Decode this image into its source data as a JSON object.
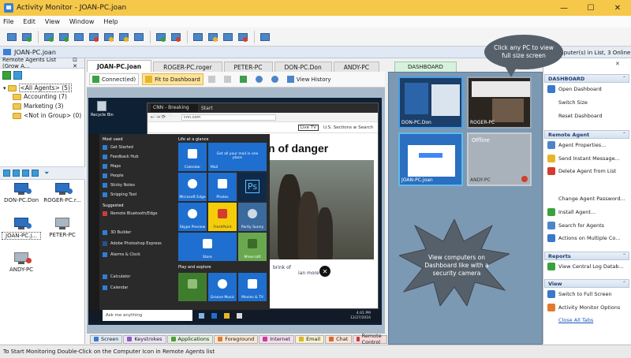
{
  "window": {
    "title": "Activity Monitor - JOAN-PC.joan",
    "min": "—",
    "max": "☐",
    "close": "✕"
  },
  "menu": [
    "File",
    "Edit",
    "View",
    "Window",
    "Help"
  ],
  "location": "JOAN-PC.joan",
  "left": {
    "header": "Remote Agents List (Grow A...",
    "header_btns": "⊡ ✕",
    "tree": {
      "all": "<All Agents> (5)",
      "accounting": "Accounting (7)",
      "marketing": "Marketing (3)",
      "notin": "<Not in Group> (0)"
    },
    "filter": "⏷",
    "computers": [
      {
        "name": "DON-PC.Don",
        "status": "blue"
      },
      {
        "name": "ROGER-PC.r...",
        "status": "blue"
      },
      {
        "name": "JOAN-PC.j...",
        "status": "blue"
      },
      {
        "name": "PETER-PC",
        "status": "gray"
      },
      {
        "name": "ANDY-PC",
        "status": "red"
      }
    ]
  },
  "tabs": [
    "JOAN-PC.joan",
    "ROGER-PC.roger",
    "PETER-PC",
    "DON-PC.Don",
    "ANDY-PC"
  ],
  "view_tools": {
    "connect": "Connect(ed)",
    "fit": "Fit to Dashboard",
    "history": "View History"
  },
  "remote": {
    "recycle": "Recycle Bin",
    "browser_tab": "CNN - Breaking News, U...",
    "browser_tab2": "Start",
    "address": "cnn.com",
    "live": "Live TV",
    "nav": "U.S.  Sections ≡  Search",
    "headline": "n of danger",
    "caption": "brink of",
    "caption2": "ian more",
    "close_x": "✕",
    "start_header": "Most used",
    "start_items": [
      "Get Started",
      "Feedback Hub",
      "Maps",
      "People",
      "Sticky Notes",
      "Snipping Tool"
    ],
    "suggested": "Suggested",
    "suggested_item": "Remote Bluetooth/Edge",
    "apps": [
      "3D Builder",
      "Adobe Photoshop Express",
      "Alarms & Clock",
      "Calculator",
      "Calendar"
    ],
    "life_header": "Life at a glance",
    "play_header": "Play and explore",
    "tiles": [
      "Calendar",
      "Get all your mail in one place",
      "Mail",
      "Microsoft Edge",
      "Photos",
      "Ps",
      "Skype Preview",
      "Partly Sunny",
      "FreshPaint",
      "Store",
      "Minecraft",
      "Groove Music",
      "Movies & TV",
      "Xbox"
    ],
    "weather": "Partly Sunny",
    "search": "Ask me anything",
    "clock_time": "4:41 PM",
    "clock_date": "12/27/2016"
  },
  "bottom_tabs": [
    {
      "label": "Screen",
      "color": "#3a78c8"
    },
    {
      "label": "Keystrokes",
      "color": "#8a5cc2"
    },
    {
      "label": "Applications",
      "color": "#4f9e3d"
    },
    {
      "label": "Foreground",
      "color": "#e07b2d"
    },
    {
      "label": "Internet",
      "color": "#c93c9a"
    },
    {
      "label": "Email",
      "color": "#d9b52a"
    },
    {
      "label": "Chat",
      "color": "#d86a2e"
    },
    {
      "label": "Remote Control",
      "color": "#c63c3c"
    }
  ],
  "dashboard": {
    "tab": "DASHBOARD",
    "thumbs": [
      "DON-PC.Don",
      "ROGER-PC",
      "JOAN-PC.joan",
      "ANDY-PC"
    ],
    "offline": "Offline"
  },
  "right": {
    "header": "5 Computer(s) in List, 3 Online",
    "close": "✕",
    "sections": [
      {
        "title": "DASHBOARD",
        "items": [
          "Open Dashboard",
          "Switch Size",
          "Reset Dashboard"
        ]
      },
      {
        "title": "Remote Agent",
        "items": [
          "Agent Properties...",
          "Send Instant Message...",
          "Delete Agent from List",
          "Change Agent Password...",
          "Install Agent...",
          "Search for Agents",
          "Actions on Multiple Co..."
        ]
      },
      {
        "title": "Reports",
        "items": [
          "View Central Log Datab..."
        ]
      },
      {
        "title": "View",
        "items": [
          "Switch to Full Screen",
          "Activity Monitor Options",
          "Close All Tabs"
        ]
      }
    ]
  },
  "callouts": {
    "bubble": "Click any PC to view full size screen",
    "star": "View computers on Dashboard like with a security camera"
  },
  "status": "To Start Monitoring Double-Click on the Computer Icon in Remote Agents list"
}
